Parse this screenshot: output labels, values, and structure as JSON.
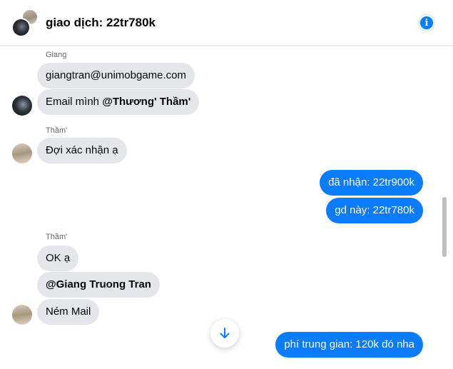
{
  "header": {
    "title": "giao dịch: 22tr780k",
    "info_icon": "info-icon",
    "accent_color": "#0a7cff"
  },
  "messages": [
    {
      "sender": "Giang",
      "text": "giangtran@unimobgame.com",
      "direction": "in"
    },
    {
      "text_prefix": "Email mình ",
      "mention": "@Thương' Thầm'",
      "direction": "in"
    },
    {
      "sender": "Thầm'",
      "text": "Đợi xác nhận ạ",
      "direction": "in"
    },
    {
      "text": "đã nhận: 22tr900k",
      "direction": "out"
    },
    {
      "text": "gd này: 22tr780k",
      "direction": "out"
    },
    {
      "sender": "Thầm'",
      "text": "OK ạ",
      "direction": "in"
    },
    {
      "mention": "@Giang Truong Tran",
      "direction": "in"
    },
    {
      "text": "Ném Mail",
      "direction": "in"
    },
    {
      "text": "phí trung gian: 120k đó nha",
      "direction": "out"
    }
  ],
  "scroll_down_icon": "arrow-down-icon"
}
